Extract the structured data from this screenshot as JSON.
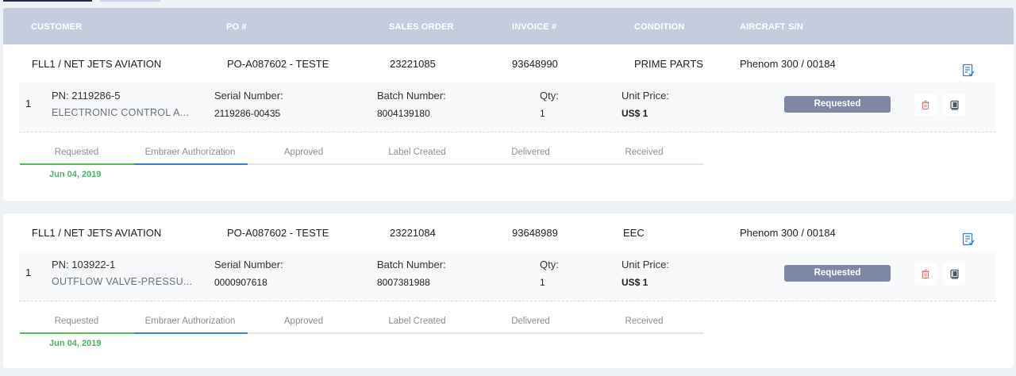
{
  "header": {
    "customer": "CUSTOMER",
    "po": "PO #",
    "sales_order": "SALES ORDER",
    "invoice": "INVOICE #",
    "condition": "CONDITION",
    "aircraft": "AIRCRAFT S/N"
  },
  "labels": {
    "serial": "Serial Number:",
    "batch": "Batch Number:",
    "qty": "Qty:",
    "unit_price": "Unit Price:"
  },
  "steps": [
    "Requested",
    "Embraer Authorization",
    "Approved",
    "Label Created",
    "Delivered",
    "Received"
  ],
  "orders": [
    {
      "customer": "FLL1 / NET JETS AVIATION",
      "po": "PO-A087602 - TESTE",
      "sales_order": "23221085",
      "invoice": "93648990",
      "condition": "PRIME PARTS",
      "aircraft": "Phenom 300 / 00184",
      "item": {
        "index": "1",
        "pn": "PN: 2119286-5",
        "description": "ELECTRONIC CONTROL A...",
        "serial": "2119286-00435",
        "batch": "8004139180",
        "qty": "1",
        "price": "US$ 1",
        "status": "Requested"
      },
      "step_date": "Jun 04, 2019"
    },
    {
      "customer": "FLL1 / NET JETS AVIATION",
      "po": "PO-A087602 - TESTE",
      "sales_order": "23221084",
      "invoice": "93648989",
      "condition": "EEC",
      "aircraft": "Phenom 300 / 00184",
      "item": {
        "index": "1",
        "pn": "PN: 103922-1",
        "description": "OUTFLOW VALVE-PRESSU...",
        "serial": "0000907618",
        "batch": "8007381988",
        "qty": "1",
        "price": "US$ 1",
        "status": "Requested"
      },
      "step_date": "Jun 04, 2019"
    }
  ],
  "colors": {
    "header_bg": "#c4ccdd",
    "status_pill": "#7e88a4",
    "step_done": "#5cb85c",
    "step_current": "#3b7dd8",
    "date_text": "#4cb06a",
    "delete_icon": "#e5736f"
  }
}
